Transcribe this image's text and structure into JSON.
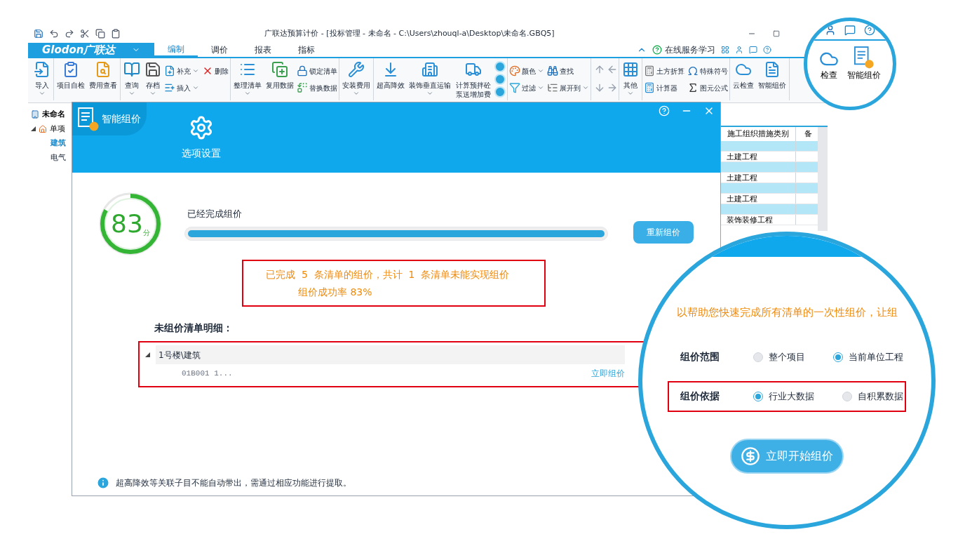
{
  "window": {
    "title": "广联达预算计价 - [投标管理 - 未命名 - C:\\Users\\zhouql-a\\Desktop\\未命名.GBQ5]"
  },
  "menu": {
    "logo": "Glodon广联达",
    "tabs": [
      {
        "label": "编制",
        "selected": true
      },
      {
        "label": "调价",
        "selected": false
      },
      {
        "label": "报表",
        "selected": false
      },
      {
        "label": "指标",
        "selected": false
      }
    ],
    "service": "在线服务学习"
  },
  "ribbon": [
    {
      "items": [
        {
          "label": "导入",
          "kind": "large",
          "dropdown": true
        }
      ]
    },
    {
      "items": [
        {
          "label": "项目自检",
          "kind": "large",
          "dropdown": false
        },
        {
          "label": "费用查看",
          "kind": "large",
          "dropdown": false
        }
      ]
    },
    {
      "items": [
        {
          "label": "查询",
          "kind": "large",
          "dropdown": true
        },
        {
          "label": "存档",
          "kind": "large",
          "dropdown": true
        },
        {
          "label": "补充",
          "kind": "small",
          "dropdown": true
        },
        {
          "label": "插入",
          "kind": "small",
          "dropdown": true
        },
        {
          "label": "删除",
          "kind": "small",
          "dropdown": false
        }
      ]
    },
    {
      "items": [
        {
          "label": "整理清单",
          "kind": "large",
          "dropdown": true
        },
        {
          "label": "复用数据",
          "kind": "large",
          "dropdown": false
        },
        {
          "label": "锁定清单",
          "kind": "small",
          "dropdown": false
        },
        {
          "label": "替换数据",
          "kind": "small",
          "dropdown": false
        }
      ]
    },
    {
      "items": [
        {
          "label": "安装费用",
          "kind": "large",
          "dropdown": true
        }
      ]
    },
    {
      "items": [
        {
          "label": "超高降效",
          "kind": "large",
          "dropdown": false
        },
        {
          "label": "装饰垂直运输",
          "kind": "large",
          "dropdown": true
        },
        {
          "label": "计算预拌砼泵送增加费",
          "kind": "large_wrapped",
          "dropdown": false
        }
      ]
    },
    {
      "items": [
        {
          "label": "颜色",
          "kind": "small",
          "dropdown": true
        },
        {
          "label": "过滤",
          "kind": "small",
          "dropdown": true
        },
        {
          "label": "查找",
          "kind": "small",
          "dropdown": false
        },
        {
          "label": "展开到",
          "kind": "small",
          "dropdown": true
        }
      ]
    },
    {
      "items": [
        {
          "label": "其他",
          "kind": "large",
          "dropdown": true
        }
      ]
    },
    {
      "items": [
        {
          "label": "土方折算",
          "kind": "small",
          "dropdown": false
        },
        {
          "label": "计算器",
          "kind": "small",
          "dropdown": false
        },
        {
          "label": "特殊符号",
          "kind": "small",
          "dropdown": false
        },
        {
          "label": "图元公式",
          "kind": "small",
          "dropdown": false
        }
      ]
    },
    {
      "items": [
        {
          "label": "云检查",
          "kind": "large",
          "dropdown": false
        },
        {
          "label": "智能组价",
          "kind": "large",
          "dropdown": false
        }
      ]
    }
  ],
  "project_tree": {
    "root": "未命名",
    "children": [
      {
        "label": "单项",
        "expanded": true,
        "children": [
          {
            "label": "建筑",
            "selected": true
          },
          {
            "label": "电气",
            "selected": false
          }
        ]
      }
    ]
  },
  "table": {
    "columns": [
      "施工组织措施类别",
      "备"
    ],
    "rows": [
      {
        "category": "",
        "highlighted": true
      },
      {
        "category": "土建工程",
        "highlighted": false
      },
      {
        "category": "",
        "highlighted": true
      },
      {
        "category": "土建工程",
        "highlighted": false
      },
      {
        "category": "",
        "highlighted": true
      },
      {
        "category": "土建工程",
        "highlighted": false
      },
      {
        "category": "",
        "highlighted": true
      },
      {
        "category": "装饰装修工程",
        "highlighted": false
      }
    ]
  },
  "dialog": {
    "title": "智能组价",
    "tab": "选项设置",
    "score": "83",
    "score_unit": "分",
    "score_ring": {
      "level": 0.83
    },
    "progress": {
      "label": "已经完成组价",
      "level": 1
    },
    "redo_button": "重新组价",
    "summary": {
      "highlighted": true,
      "line_1": "已完成  5  条清单的组价，共计  1  条清单未能实现组价",
      "line_2": "组价成功率 83%"
    },
    "unpriced_title": "未组价清单明细：",
    "unpriced": {
      "highlighted": true,
      "groups": [
        {
          "name": "1号楼\\建筑",
          "expanded": true,
          "items": [
            {
              "code": "01B001 1...",
              "action": "立即组价"
            }
          ]
        }
      ]
    },
    "note": "超高降效等关联子目不能自动带出，需通过相应功能进行提取。"
  },
  "magnifier_options": {
    "intro": "以帮助您快速完成所有清单的一次性组价，让组",
    "rows": [
      {
        "label": "组价范围",
        "highlighted": false,
        "options": [
          {
            "label": "整个项目",
            "selected": false
          },
          {
            "label": "当前单位工程",
            "selected": true
          }
        ]
      },
      {
        "label": "组价依据",
        "highlighted": true,
        "options": [
          {
            "label": "行业大数据",
            "selected": true
          },
          {
            "label": "自积累数据",
            "selected": false
          }
        ]
      }
    ],
    "start_button": "立即开始组价"
  },
  "magnifier_ribbon": {
    "items": [
      "检查",
      "智能组价"
    ]
  }
}
